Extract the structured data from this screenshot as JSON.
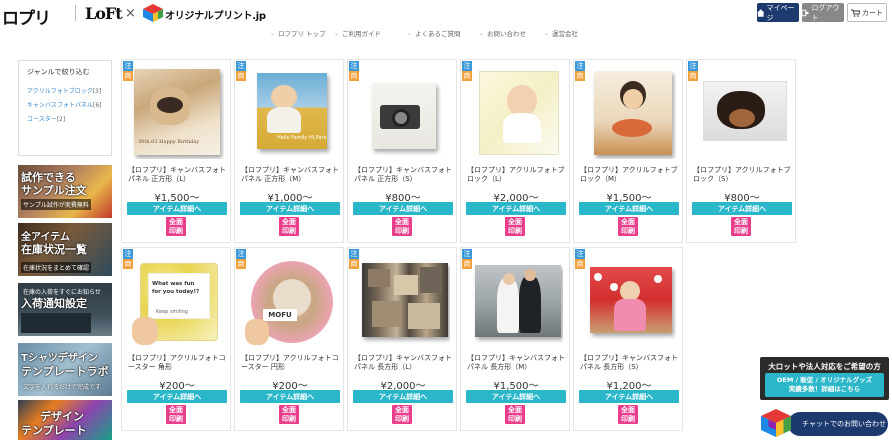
{
  "header": {
    "logo_ropuri": "ロプリ",
    "logo_loft": "LoFt",
    "logo_x": "×",
    "logo_original": "オリジナルプリント.jp",
    "mypage_label": "マイページ",
    "logout_label": "ログアウト",
    "cart_label": "カート"
  },
  "nav": {
    "items": [
      {
        "label": "ロフプリ トップ"
      },
      {
        "label": "ご利用ガイド"
      },
      {
        "label": "よくあるご質問"
      },
      {
        "label": "お問い合わせ"
      },
      {
        "label": "運営会社"
      }
    ]
  },
  "sidebar": {
    "title": "ジャンルで絞り込む",
    "genres": [
      {
        "label": "アクリルフォトブロック",
        "count": "[3]"
      },
      {
        "label": "キャンバスフォトパネル",
        "count": "[6]"
      },
      {
        "label": "コースター",
        "count": "[2]"
      }
    ],
    "banners": [
      {
        "t1": "試作できる",
        "t1b": "サンプル注文",
        "t2": "サンプル試作が実費無料"
      },
      {
        "t1": "全アイテム",
        "t1b": "在庫状況一覧",
        "t2": "在庫状況をまとめて確認"
      },
      {
        "t1": "入荷通知設定",
        "t1b": "",
        "t2": "在庫の入荷をすぐにお知らせ"
      },
      {
        "t1": "Tシャツデザイン",
        "t1b": "テンプレートラボ",
        "t2": "文字を入れるだけで完成です"
      },
      {
        "t1": "デザイン",
        "t1b": "テンプレート",
        "t2": ""
      }
    ]
  },
  "badges": {
    "b1": "注",
    "b2": "目",
    "b3": "商",
    "b4": "品"
  },
  "products": [
    {
      "name": "【ロフプリ】キャンバスフォトパネル 正方形（L）",
      "price": "¥1,500〜",
      "button": "アイテム詳細へ",
      "tag1": "全面",
      "tag2": "印刷"
    },
    {
      "name": "【ロフプリ】キャンバスフォトパネル 正方形（M）",
      "price": "¥1,000〜",
      "button": "アイテム詳細へ",
      "tag1": "全面",
      "tag2": "印刷"
    },
    {
      "name": "【ロフプリ】キャンバスフォトパネル 正方形（S）",
      "price": "¥800〜",
      "button": "アイテム詳細へ",
      "tag1": "全面",
      "tag2": "印刷"
    },
    {
      "name": "【ロフプリ】アクリルフォトブロック（L）",
      "price": "¥2,000〜",
      "button": "アイテム詳細へ",
      "tag1": "全面",
      "tag2": "印刷"
    },
    {
      "name": "【ロフプリ】アクリルフォトブロック（M）",
      "price": "¥1,500〜",
      "button": "アイテム詳細へ",
      "tag1": "全面",
      "tag2": "印刷"
    },
    {
      "name": "【ロフプリ】アクリルフォトブロック（S）",
      "price": "¥800〜",
      "button": "アイテム詳細へ",
      "tag1": "全面",
      "tag2": "印刷"
    },
    {
      "name": "【ロフプリ】アクリルフォトコースター 角形",
      "price": "¥200〜",
      "button": "アイテム詳細へ",
      "tag1": "全面",
      "tag2": "印刷"
    },
    {
      "name": "【ロフプリ】アクリルフォトコースター 円形",
      "price": "¥200〜",
      "button": "アイテム詳細へ",
      "tag1": "全面",
      "tag2": "印刷"
    },
    {
      "name": "【ロフプリ】キャンバスフォトパネル 長方形（L）",
      "price": "¥2,000〜",
      "button": "アイテム詳細へ",
      "tag1": "全面",
      "tag2": "印刷"
    },
    {
      "name": "【ロフプリ】キャンバスフォトパネル 長方形（M）",
      "price": "¥1,500〜",
      "button": "アイテム詳細へ",
      "tag1": "全面",
      "tag2": "印刷"
    },
    {
      "name": "【ロフプリ】キャンバスフォトパネル 長方形（S）",
      "price": "¥1,200〜",
      "button": "アイテム詳細へ",
      "tag1": "全面",
      "tag2": "印刷"
    }
  ],
  "photo_text": {
    "p1": "30th.03 Happy Birthday",
    "p2": "Hello Family Hi,Park",
    "p7a": "What was fun",
    "p7b": "for you today!?",
    "p7c": "Keep smiling",
    "p8": "MOFU"
  },
  "bulk": {
    "title": "大ロットや法人対応をご希望の方",
    "line1": "OEM / 販促 / オリジナルグッズ",
    "line2": "実績多数！詳細はこちら"
  },
  "chat": {
    "label": "チャットでのお問い合わせ"
  }
}
